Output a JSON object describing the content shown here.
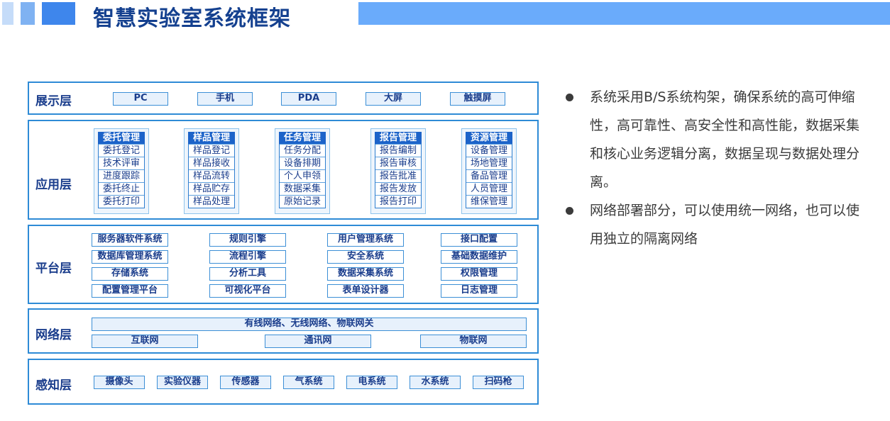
{
  "header": {
    "title": "智慧实验室系统框架"
  },
  "layers": {
    "display": {
      "label": "展示层",
      "items": [
        "PC",
        "手机",
        "PDA",
        "大屏",
        "触摸屏"
      ]
    },
    "application": {
      "label": "应用层",
      "modules": [
        {
          "title": "委托管理",
          "items": [
            "委托登记",
            "技术评审",
            "进度跟踪",
            "委托终止",
            "委托打印"
          ]
        },
        {
          "title": "样品管理",
          "items": [
            "样品登记",
            "样品接收",
            "样品流转",
            "样品贮存",
            "样品处理"
          ]
        },
        {
          "title": "任务管理",
          "items": [
            "任务分配",
            "设备排期",
            "个人申领",
            "数据采集",
            "原始记录"
          ]
        },
        {
          "title": "报告管理",
          "items": [
            "报告编制",
            "报告审核",
            "报告批准",
            "报告发放",
            "报告打印"
          ]
        },
        {
          "title": "资源管理",
          "items": [
            "设备管理",
            "场地管理",
            "备品管理",
            "人员管理",
            "维保管理"
          ]
        }
      ]
    },
    "platform": {
      "label": "平台层",
      "columns": [
        [
          "服务器软件系统",
          "数据库管理系统",
          "存储系统",
          "配置管理平台"
        ],
        [
          "规则引擎",
          "流程引擎",
          "分析工具",
          "可视化平台"
        ],
        [
          "用户管理系统",
          "安全系统",
          "数据采集系统",
          "表单设计器"
        ],
        [
          "接口配置",
          "基础数据维护",
          "权限管理",
          "日志管理"
        ]
      ]
    },
    "network": {
      "label": "网络层",
      "top": "有线网络、无线网络、物联网关",
      "items": [
        "互联网",
        "通讯网",
        "物联网"
      ]
    },
    "perception": {
      "label": "感知层",
      "items": [
        "摄像头",
        "实验仪器",
        "传感器",
        "气系统",
        "电系统",
        "水系统",
        "扫码枪"
      ]
    }
  },
  "bullets": [
    "系统采用B/S系统构架，确保系统的高可伸缩性，高可靠性、高安全性和高性能，数据采集和核心业务逻辑分离，数据呈现与数据处理分离。",
    "网络部署部分，可以使用统一网络，也可以使用独立的隔离网络"
  ]
}
